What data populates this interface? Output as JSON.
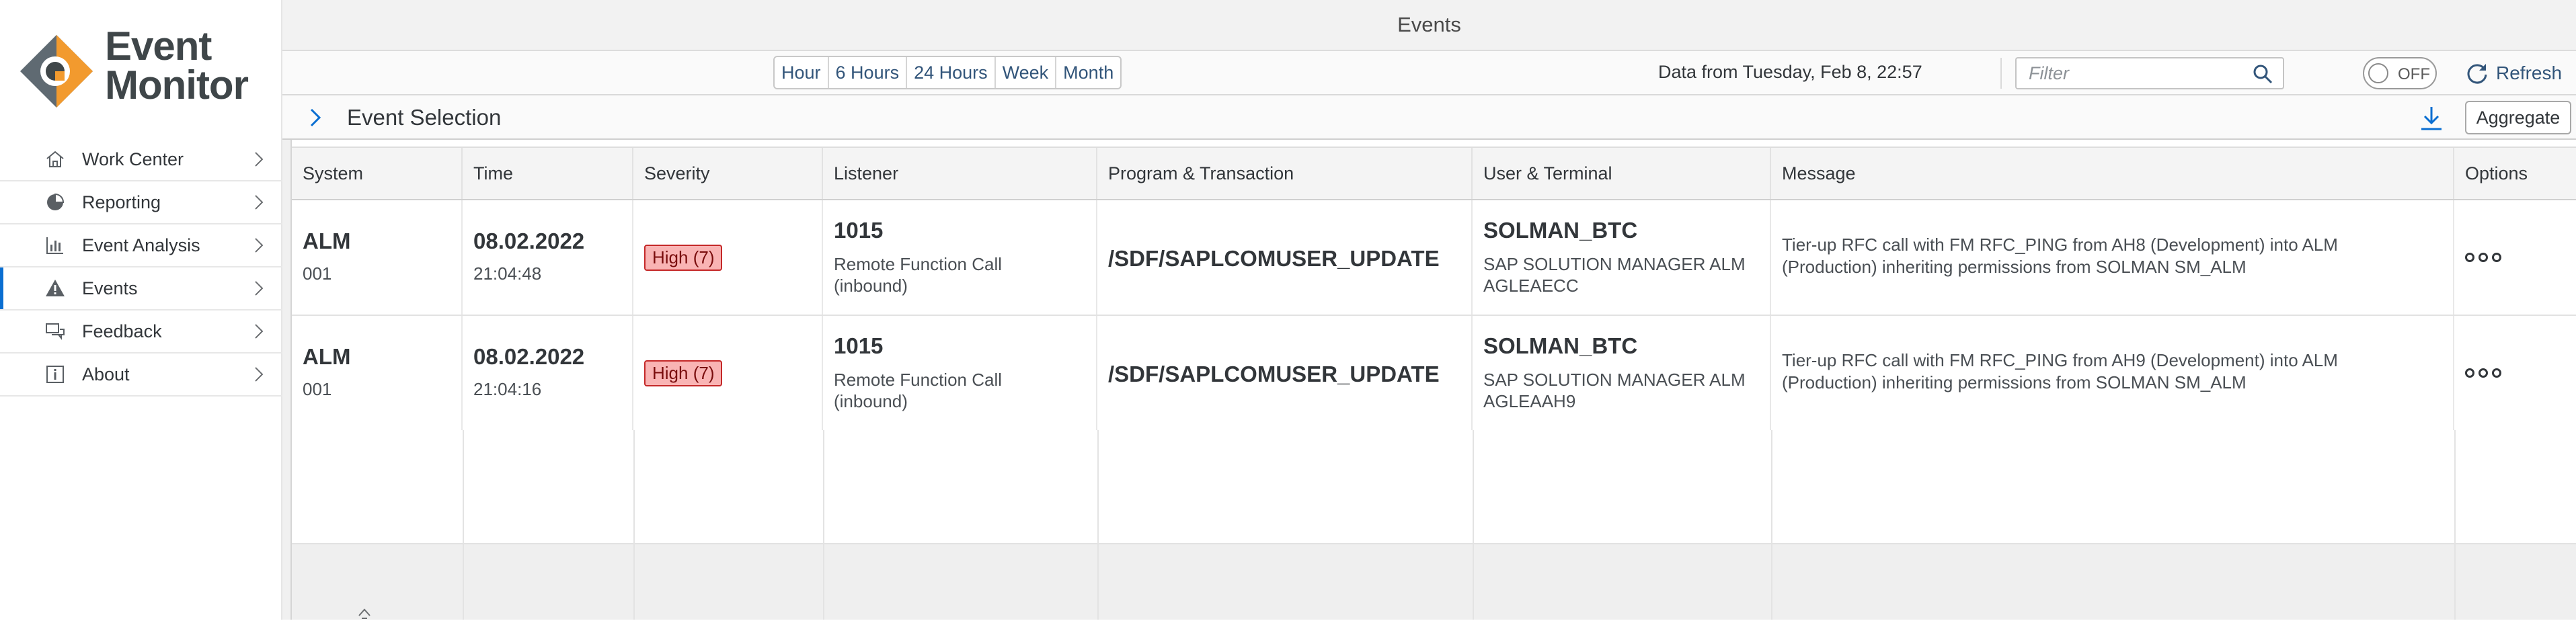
{
  "app": {
    "logo_line1": "Event",
    "logo_line2": "Monitor",
    "window_title": "Events"
  },
  "sidebar": {
    "items": [
      {
        "label": "Work Center",
        "icon": "home-icon"
      },
      {
        "label": "Reporting",
        "icon": "pie-chart-icon"
      },
      {
        "label": "Event Analysis",
        "icon": "bar-chart-icon"
      },
      {
        "label": "Events",
        "icon": "warning-icon",
        "active": true
      },
      {
        "label": "Feedback",
        "icon": "feedback-icon"
      },
      {
        "label": "About",
        "icon": "info-icon"
      }
    ]
  },
  "toolbar": {
    "ranges": [
      "Hour",
      "6 Hours",
      "24 Hours",
      "Week",
      "Month"
    ],
    "data_from": "Data from Tuesday, Feb 8, 22:57",
    "filter_placeholder": "Filter",
    "toggle_label": "OFF",
    "refresh_label": "Refresh"
  },
  "selection": {
    "title": "Event Selection",
    "aggregate_label": "Aggregate"
  },
  "table": {
    "columns": [
      "System",
      "Time",
      "Severity",
      "Listener",
      "Program & Transaction",
      "User & Terminal",
      "Message",
      "Options"
    ],
    "rows": [
      {
        "system": "ALM",
        "client": "001",
        "date": "08.02.2022",
        "time": "21:04:48",
        "severity": "High (7)",
        "listener_id": "1015",
        "listener_line1": "Remote Function Call",
        "listener_line2": "(inbound)",
        "program": "/SDF/SAPLCOMUSER_UPDATE",
        "user": "SOLMAN_BTC",
        "terminal_line1": "SAP SOLUTION MANAGER ALM",
        "terminal_line2": "AGLEAECC",
        "message_line1": "Tier-up RFC call with FM RFC_PING from AH8 (Development) into ALM",
        "message_line2": "(Production) inheriting permissions from SOLMAN SM_ALM"
      },
      {
        "system": "ALM",
        "client": "001",
        "date": "08.02.2022",
        "time": "21:04:16",
        "severity": "High (7)",
        "listener_id": "1015",
        "listener_line1": "Remote Function Call",
        "listener_line2": "(inbound)",
        "program": "/SDF/SAPLCOMUSER_UPDATE",
        "user": "SOLMAN_BTC",
        "terminal_line1": "SAP SOLUTION MANAGER ALM",
        "terminal_line2": "AGLEAAH9",
        "message_line1": "Tier-up RFC call with FM RFC_PING from AH9 (Development) into ALM",
        "message_line2": "(Production) inheriting permissions from SOLMAN SM_ALM"
      }
    ]
  },
  "colors": {
    "accent": "#0a6ed1",
    "logo_orange": "#f29a2e",
    "logo_grey": "#5f6a72",
    "severity_high_bg": "#f9b4b4",
    "severity_high_border": "#c42828"
  }
}
